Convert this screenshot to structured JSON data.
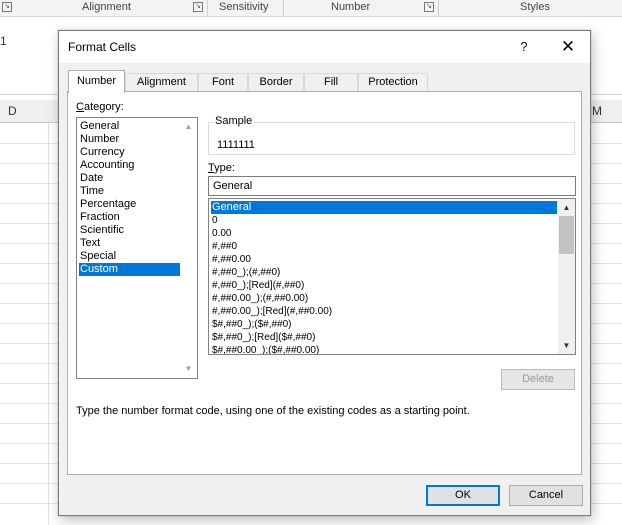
{
  "ribbon": {
    "groups": [
      "Alignment",
      "Sensitivity",
      "Number",
      "Styles"
    ],
    "launcher_glyph": "↘"
  },
  "sheet": {
    "cell_reference": "1",
    "columns": [
      "D",
      "M"
    ]
  },
  "dialog": {
    "title": "Format Cells",
    "help_label": "?",
    "close_label": "✕",
    "tabs": [
      "Number",
      "Alignment",
      "Font",
      "Border",
      "Fill",
      "Protection"
    ],
    "active_tab": "Number",
    "category": {
      "label_underlined": "C",
      "label_rest": "ategory:",
      "items": [
        "General",
        "Number",
        "Currency",
        "Accounting",
        "Date",
        "Time",
        "Percentage",
        "Fraction",
        "Scientific",
        "Text",
        "Special",
        "Custom"
      ],
      "selected": "Custom"
    },
    "sample": {
      "label": "Sample",
      "value": "1111111"
    },
    "type": {
      "label_underlined": "T",
      "label_rest": "ype:",
      "value": "General"
    },
    "formats": [
      "General",
      "0",
      "0.00",
      "#,##0",
      "#,##0.00",
      "#,##0_);(#,##0)",
      "#,##0_);[Red](#,##0)",
      "#,##0.00_);(#,##0.00)",
      "#,##0.00_);[Red](#,##0.00)",
      "$#,##0_);($#,##0)",
      "$#,##0_);[Red]($#,##0)",
      "$#,##0.00_);($#,##0.00)"
    ],
    "selected_format": "General",
    "delete_label": "Delete",
    "hint": "Type the number format code, using one of the existing codes as a starting point.",
    "ok_label": "OK",
    "cancel_label": "Cancel"
  },
  "colors": {
    "selection": "#0078d7",
    "dialog_bg": "#f0f0f0"
  }
}
